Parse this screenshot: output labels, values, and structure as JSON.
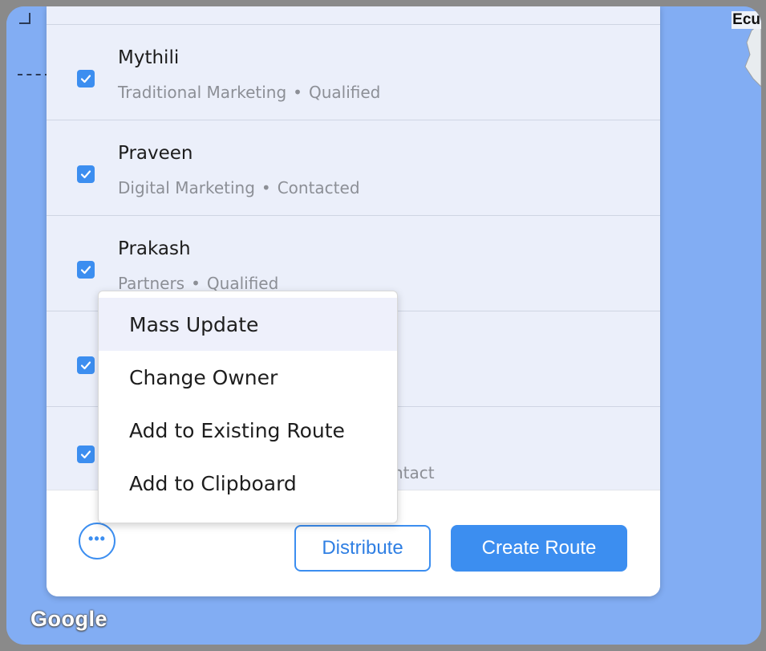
{
  "map": {
    "country_label": "Ecu",
    "attribution": "Google"
  },
  "leads": [
    {
      "name": "Mythili",
      "source": "Traditional Marketing",
      "status": "Qualified",
      "checked": true
    },
    {
      "name": "Praveen",
      "source": "Digital Marketing",
      "status": "Contacted",
      "checked": true
    },
    {
      "name": "Prakash",
      "source": "Partners",
      "status": "Qualified",
      "checked": true
    },
    {
      "name": "",
      "source": "",
      "status": "",
      "checked": true
    },
    {
      "name": "",
      "source": "",
      "status": "ntact",
      "checked": true
    }
  ],
  "context_menu": {
    "items": [
      "Mass Update",
      "Change Owner",
      "Add to Existing Route",
      "Add to Clipboard"
    ],
    "highlighted_index": 0
  },
  "footer": {
    "more_icon": "ellipsis-icon",
    "distribute_label": "Distribute",
    "create_route_label": "Create Route"
  },
  "colors": {
    "accent": "#3c8ef0",
    "map_water": "#82adf3",
    "list_bg": "#ebeffa"
  }
}
